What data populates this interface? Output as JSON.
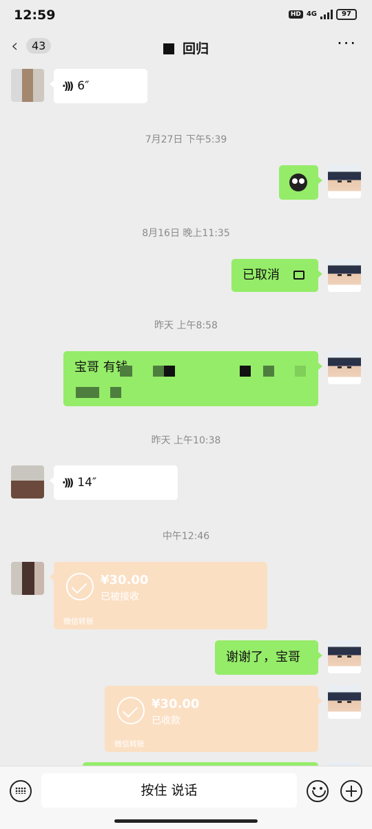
{
  "status": {
    "time": "12:59",
    "hd": "HD",
    "network": "4G",
    "battery": "97"
  },
  "header": {
    "unread_count": "43",
    "title": "回归"
  },
  "messages": {
    "voice1": "6″",
    "stamp1": "7月27日 下午5:39",
    "stamp2": "8月16日 晚上11:35",
    "cancelled": "已取消",
    "stamp3": "昨天 上午8:58",
    "long_text_visible": "宝哥 有钱",
    "stamp4": "昨天 上午10:38",
    "voice2": "14″",
    "stamp5": "中午12:46",
    "transfer1": {
      "amount": "¥30.00",
      "status": "已被接收",
      "label": "微信转账"
    },
    "thanks": "谢谢了，宝哥",
    "transfer2": {
      "amount": "¥30.00",
      "status": "已收款",
      "label": "微信转账"
    }
  },
  "input": {
    "talk_label": "按住 说话"
  }
}
